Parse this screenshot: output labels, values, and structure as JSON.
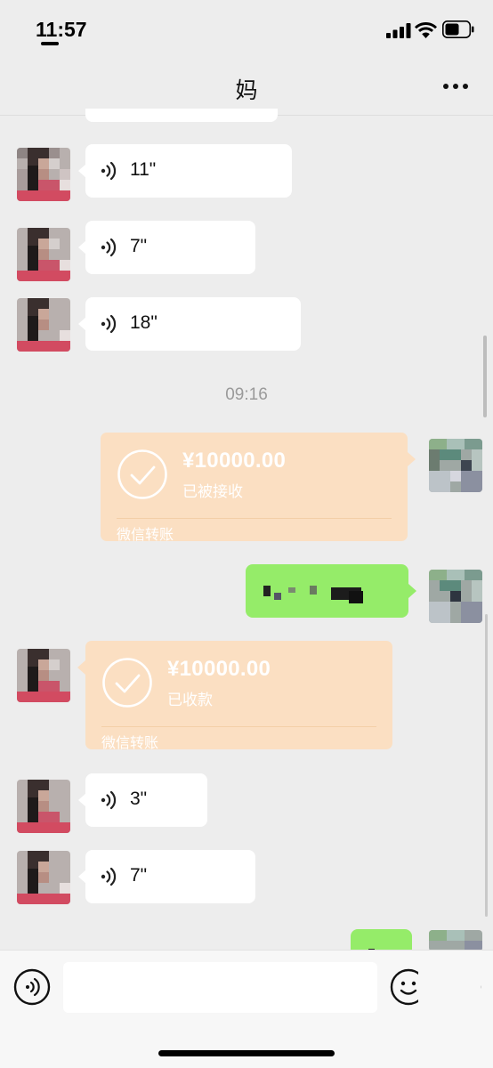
{
  "status_bar": {
    "time": "11:57"
  },
  "nav": {
    "title": "妈"
  },
  "messages": {
    "voice_1": "11\"",
    "voice_2": "7\"",
    "voice_3": "18\"",
    "time_label": "09:16",
    "transfer_sent": {
      "amount": "¥10000.00",
      "status": "已被接收",
      "footer": "微信转账"
    },
    "transfer_received": {
      "amount": "¥10000.00",
      "status": "已收款",
      "footer": "微信转账"
    },
    "voice_4": "3\"",
    "voice_5": "7\""
  },
  "input_bar": {
    "placeholder": ""
  },
  "colors": {
    "background": "#ededed",
    "bubble_green": "#95ec69",
    "transfer_orange": "#fbdfc2"
  }
}
